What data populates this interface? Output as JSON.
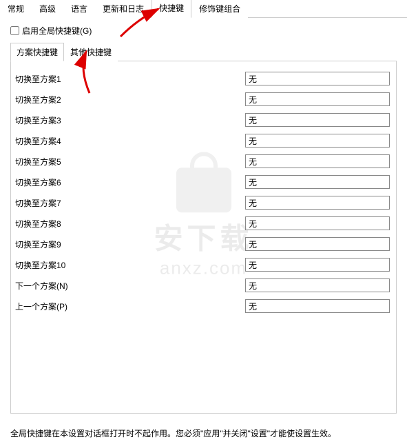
{
  "main_tabs": [
    "常规",
    "高级",
    "语言",
    "更新和日志",
    "快捷键",
    "修饰键组合"
  ],
  "active_main_tab": 4,
  "enable_global_label": "启用全局快捷键(G)",
  "sub_tabs": [
    "方案快捷键",
    "其他快捷键"
  ],
  "active_sub_tab": 0,
  "rows": [
    {
      "label": "切换至方案1",
      "value": "无"
    },
    {
      "label": "切换至方案2",
      "value": "无"
    },
    {
      "label": "切换至方案3",
      "value": "无"
    },
    {
      "label": "切换至方案4",
      "value": "无"
    },
    {
      "label": "切换至方案5",
      "value": "无"
    },
    {
      "label": "切换至方案6",
      "value": "无"
    },
    {
      "label": "切换至方案7",
      "value": "无"
    },
    {
      "label": "切换至方案8",
      "value": "无"
    },
    {
      "label": "切换至方案9",
      "value": "无"
    },
    {
      "label": "切换至方案10",
      "value": "无"
    },
    {
      "label": "下一个方案(N)",
      "value": "无"
    },
    {
      "label": "上一个方案(P)",
      "value": "无"
    }
  ],
  "footer_note": "全局快捷键在本设置对话框打开时不起作用。您必须\"应用\"并关闭\"设置\"才能使设置生效。",
  "watermark": {
    "cn": "安下载",
    "en": "anxz.com"
  }
}
